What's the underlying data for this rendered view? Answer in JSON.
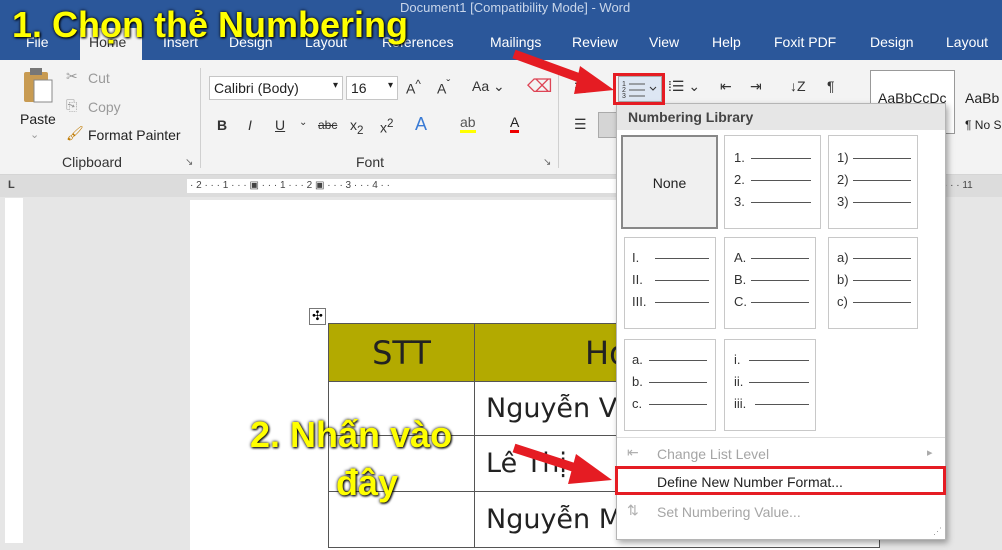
{
  "window": {
    "title": "Document1 [Compatibility Mode] - Word"
  },
  "tabs": [
    "File",
    "Home",
    "Insert",
    "Design",
    "Layout",
    "References",
    "Mailings",
    "Review",
    "View",
    "Help",
    "Foxit PDF",
    "Design",
    "Layout"
  ],
  "clipboard": {
    "paste": "Paste",
    "cut": "Cut",
    "copy": "Copy",
    "format_painter": "Format Painter",
    "group_label": "Clipboard"
  },
  "font": {
    "name": "Calibri (Body)",
    "size": "16",
    "group_label": "Font",
    "aa_label": "Aa"
  },
  "styles": {
    "style1": "AaBbCcDc",
    "style2": "AaBb",
    "style2_label": "¶ No S"
  },
  "ruler": {
    "marks": "· 2 · · · 1 · · · ▣ · · · 1 · · · 2 ▣ · · · 3 · · · 4 · ·",
    "right": "· · · 11"
  },
  "table": {
    "header": [
      "STT",
      "Hd"
    ],
    "rows": [
      [
        "",
        "Nguyễn V"
      ],
      [
        "",
        "Lê Thị"
      ],
      [
        "",
        "Nguyễn M"
      ]
    ]
  },
  "menu": {
    "header": "Numbering Library",
    "none_label": "None",
    "tiles": [
      [
        "1.",
        "2.",
        "3."
      ],
      [
        "1)",
        "2)",
        "3)"
      ],
      [
        "I.",
        "II.",
        "III."
      ],
      [
        "A.",
        "B.",
        "C."
      ],
      [
        "a)",
        "b)",
        "c)"
      ],
      [
        "a.",
        "b.",
        "c."
      ],
      [
        "i.",
        "ii.",
        "iii."
      ]
    ],
    "change_level": "Change List Level",
    "define_new": "Define New Number Format...",
    "set_value": "Set Numbering Value..."
  },
  "annotations": {
    "step1": "1. Chọn thẻ Numbering",
    "step2_line1": "2. Nhấn vào",
    "step2_line2": "đây"
  },
  "colors": {
    "word_blue": "#2b579a",
    "highlight_red": "#e51c23",
    "annotation_yellow": "#ffff00",
    "table_header": "#b3aa00"
  }
}
